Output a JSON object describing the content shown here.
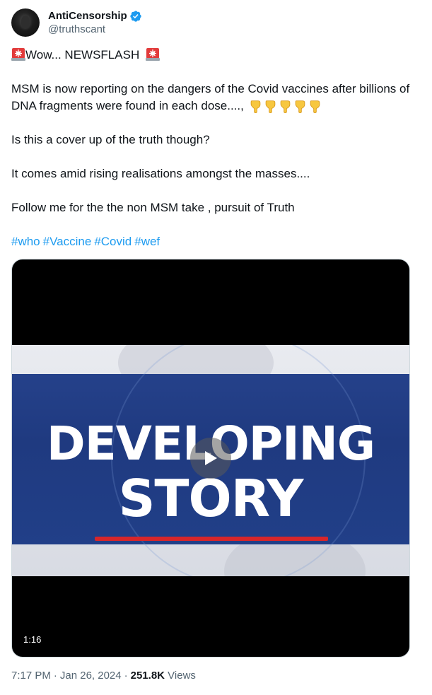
{
  "author": {
    "display_name": "AntiCensorship",
    "handle": "@truthscant",
    "verified": true
  },
  "tweet": {
    "line1_text": "Wow... NEWSFLASH",
    "paragraph2": "MSM is now reporting on the dangers of the Covid vaccines after billions of DNA fragments were found in each dose....,",
    "paragraph3": "Is this a cover up of the truth though?",
    "paragraph4": "It comes amid rising realisations amongst the masses....",
    "paragraph5": "Follow me for the the non MSM take , pursuit of Truth",
    "hashtags": [
      "#who",
      "#Vaccine",
      "#Covid",
      "#wef"
    ]
  },
  "media": {
    "headline_line1": "DEVELOPING",
    "headline_line2": "STORY",
    "duration": "1:16"
  },
  "meta": {
    "time": "7:17 PM",
    "date": "Jan 26, 2024",
    "views_count": "251.8K",
    "views_label": "Views"
  },
  "icons": {
    "siren": "police-car-light-emoji",
    "hand": "backhand-index-pointing-down-emoji",
    "verified": "verified-badge-icon",
    "play": "play-icon"
  },
  "colors": {
    "link": "#1d9bf0",
    "secondary_text": "#536471",
    "verified": "#1d9bf0",
    "band": "#213f88",
    "accent_red": "#d8262a"
  }
}
